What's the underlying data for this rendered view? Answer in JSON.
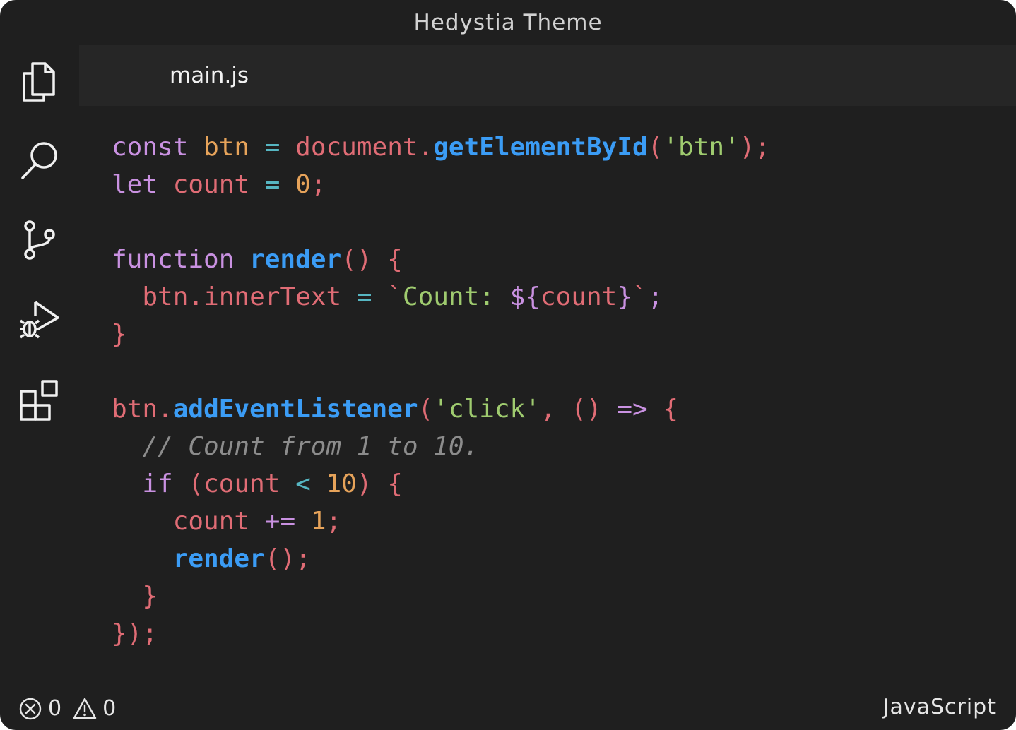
{
  "window": {
    "title": "Hedystia Theme"
  },
  "activity_bar": {
    "items": [
      "explorer-icon",
      "search-icon",
      "source-control-icon",
      "run-debug-icon",
      "extensions-icon"
    ]
  },
  "tabs": [
    {
      "label": "main.js",
      "active": true
    }
  ],
  "code": {
    "lines": [
      [
        {
          "t": "const",
          "c": "kw"
        },
        {
          "t": " "
        },
        {
          "t": "btn",
          "c": "dec"
        },
        {
          "t": " "
        },
        {
          "t": "=",
          "c": "op"
        },
        {
          "t": " "
        },
        {
          "t": "document",
          "c": "obj"
        },
        {
          "t": ".",
          "c": "pun"
        },
        {
          "t": "getElementById",
          "c": "fn"
        },
        {
          "t": "(",
          "c": "pun"
        },
        {
          "t": "'btn'",
          "c": "str"
        },
        {
          "t": ");",
          "c": "pun"
        }
      ],
      [
        {
          "t": "let",
          "c": "kw"
        },
        {
          "t": " "
        },
        {
          "t": "count",
          "c": "var"
        },
        {
          "t": " "
        },
        {
          "t": "=",
          "c": "op"
        },
        {
          "t": " "
        },
        {
          "t": "0",
          "c": "num"
        },
        {
          "t": ";",
          "c": "pun"
        }
      ],
      [],
      [
        {
          "t": "function",
          "c": "kw"
        },
        {
          "t": " "
        },
        {
          "t": "render",
          "c": "fn"
        },
        {
          "t": "() {",
          "c": "pun"
        }
      ],
      [
        {
          "t": "  "
        },
        {
          "t": "btn",
          "c": "var"
        },
        {
          "t": ".",
          "c": "pun"
        },
        {
          "t": "innerText",
          "c": "var"
        },
        {
          "t": " "
        },
        {
          "t": "=",
          "c": "op"
        },
        {
          "t": " "
        },
        {
          "t": "`",
          "c": "pun"
        },
        {
          "t": "Count: ",
          "c": "str"
        },
        {
          "t": "${",
          "c": "tmp"
        },
        {
          "t": "count",
          "c": "var"
        },
        {
          "t": "}",
          "c": "tmp"
        },
        {
          "t": "`",
          "c": "pun"
        },
        {
          "t": ";",
          "c": "tmp"
        }
      ],
      [
        {
          "t": "}",
          "c": "pun"
        }
      ],
      [],
      [
        {
          "t": "btn",
          "c": "var"
        },
        {
          "t": ".",
          "c": "pun"
        },
        {
          "t": "addEventListener",
          "c": "fn"
        },
        {
          "t": "(",
          "c": "pun"
        },
        {
          "t": "'click'",
          "c": "str"
        },
        {
          "t": ", ",
          "c": "pun"
        },
        {
          "t": "()",
          "c": "pun"
        },
        {
          "t": " "
        },
        {
          "t": "=>",
          "c": "kw"
        },
        {
          "t": " "
        },
        {
          "t": "{",
          "c": "pun"
        }
      ],
      [
        {
          "t": "  "
        },
        {
          "t": "// Count from 1 to 10.",
          "c": "com"
        }
      ],
      [
        {
          "t": "  "
        },
        {
          "t": "if",
          "c": "kw"
        },
        {
          "t": " "
        },
        {
          "t": "(",
          "c": "pun"
        },
        {
          "t": "count",
          "c": "var"
        },
        {
          "t": " "
        },
        {
          "t": "<",
          "c": "op"
        },
        {
          "t": " "
        },
        {
          "t": "10",
          "c": "num"
        },
        {
          "t": ")",
          "c": "pun"
        },
        {
          "t": " "
        },
        {
          "t": "{",
          "c": "pun"
        }
      ],
      [
        {
          "t": "    "
        },
        {
          "t": "count",
          "c": "var"
        },
        {
          "t": " "
        },
        {
          "t": "+=",
          "c": "kw"
        },
        {
          "t": " "
        },
        {
          "t": "1",
          "c": "num"
        },
        {
          "t": ";",
          "c": "pun"
        }
      ],
      [
        {
          "t": "    "
        },
        {
          "t": "render",
          "c": "fn"
        },
        {
          "t": "();",
          "c": "pun"
        }
      ],
      [
        {
          "t": "  "
        },
        {
          "t": "}",
          "c": "pun"
        }
      ],
      [
        {
          "t": "});",
          "c": "pun"
        }
      ]
    ]
  },
  "status_bar": {
    "errors": "0",
    "warnings": "0",
    "language": "JavaScript"
  },
  "colors": {
    "background": "#1f1f1f",
    "tab_bar": "#262626",
    "keyword": "#c991e1",
    "variable": "#e06c75",
    "declaration": "#e6a35a",
    "operator": "#56b6c2",
    "function": "#3b9cf5",
    "string": "#9fcb6f",
    "number": "#e6a35a",
    "comment": "#8c8c8c"
  }
}
